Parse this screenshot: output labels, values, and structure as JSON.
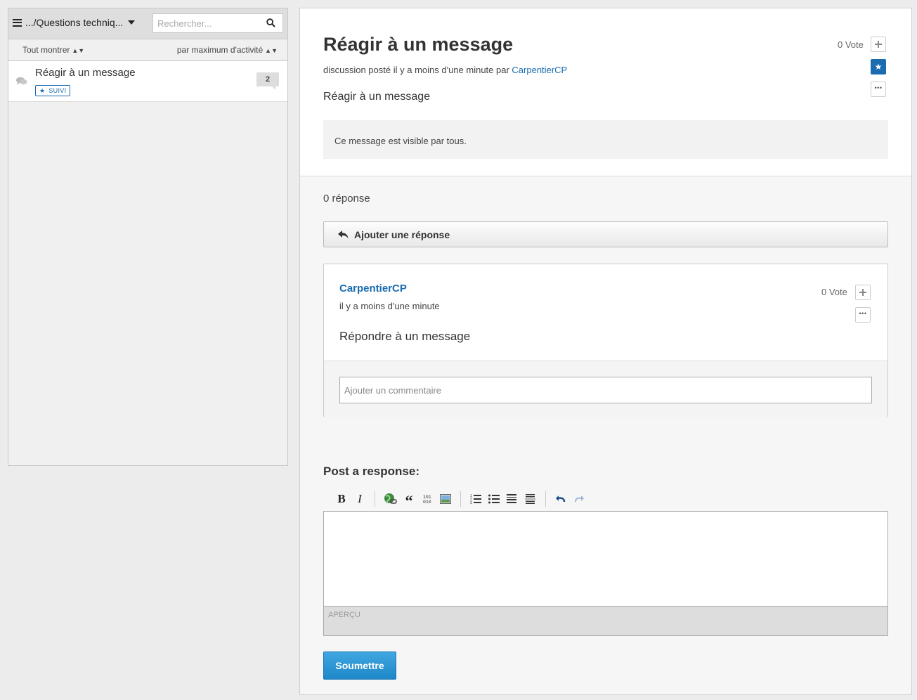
{
  "colors": {
    "accent": "#1a6bb0",
    "submit": "#2a95d6",
    "sidebar_bg": "#f0f0f0",
    "header_bg": "#dedede"
  },
  "sidebar": {
    "browse_label": ".../Questions techniq...",
    "search_placeholder": "Rechercher...",
    "filter_label": "Tout montrer",
    "sort_label": "par maximum d'activité",
    "threads": [
      {
        "title": "Réagir à un message",
        "badge": "SUIVI",
        "count": "2",
        "icon": "comments-icon"
      }
    ]
  },
  "post": {
    "title": "Réagir à un message",
    "meta_prefix": "discussion posté il y a moins d'une minute par",
    "author": "CarpentierCP",
    "body": "Réagir à un message",
    "visibility": "Ce message est visible par tous.",
    "votes": "0 Vote"
  },
  "responses": {
    "count_label": "0 réponse",
    "add_label": "Ajouter une réponse",
    "items": [
      {
        "author": "CarpentierCP",
        "time": "il y a moins d'une minute",
        "votes": "0 Vote",
        "body": "Répondre à un message",
        "comment_placeholder": "Ajouter un commentaire"
      }
    ]
  },
  "editor": {
    "heading": "Post a response:",
    "toolbar": {
      "bold": "B",
      "italic": "I",
      "icons": [
        "bold-icon",
        "italic-icon",
        "link-icon",
        "quote-icon",
        "code-icon",
        "image-icon",
        "numbered-list-icon",
        "bulleted-list-icon",
        "heading-icon",
        "horizontal-rule-icon",
        "undo-icon",
        "redo-icon"
      ]
    },
    "preview_label": "APERÇU",
    "submit_label": "Soumettre"
  }
}
